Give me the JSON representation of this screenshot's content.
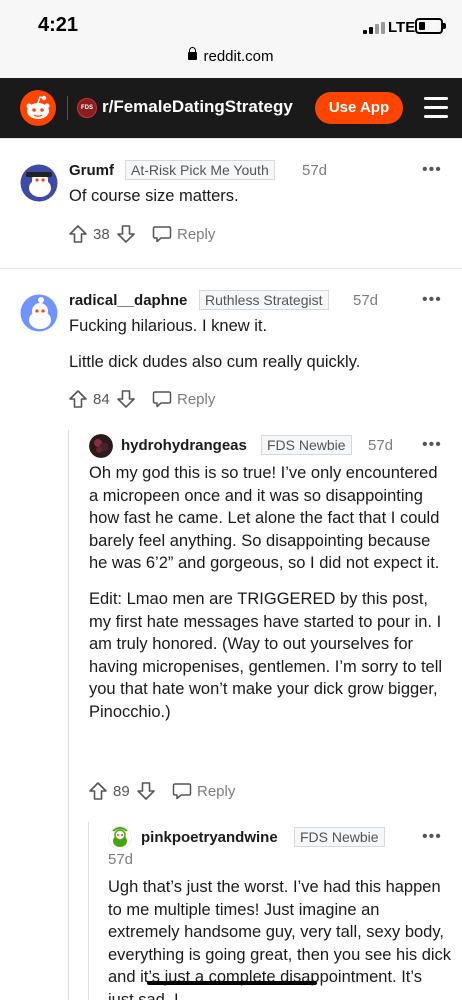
{
  "status": {
    "time": "4:21",
    "network": "LTE"
  },
  "browser": {
    "url": "reddit.com"
  },
  "header": {
    "subreddit_icon_text": "FDS",
    "subreddit": "r/FemaleDatingStrategy",
    "use_app_label": "Use App"
  },
  "comments": [
    {
      "username": "Grumf",
      "flair": "At-Risk Pick Me Youth",
      "age": "57d",
      "paragraphs": [
        "Of course size matters."
      ],
      "score": "38",
      "reply_label": "Reply"
    },
    {
      "username": "radical__daphne",
      "flair": "Ruthless Strategist",
      "age": "57d",
      "paragraphs": [
        "Fucking hilarious. I knew it.",
        "Little dick dudes also cum really quickly."
      ],
      "score": "84",
      "reply_label": "Reply"
    },
    {
      "username": "hydrohydrangeas",
      "flair": "FDS Newbie",
      "age": "57d",
      "paragraphs": [
        "Oh my god this is so true! I’ve only encountered a micropeen once and it was so disappointing how fast he came. Let alone the fact that I could barely feel anything. So disappointing because he was 6’2” and gorgeous, so I did not expect it.",
        "Edit: Lmao men are TRIGGERED by this post, my first hate messages have started to pour in. I am truly honored. (Way to out yourselves for having micropenises, gentlemen. I’m sorry to tell you that hate won’t make your dick grow bigger, Pinocchio.)"
      ],
      "score": "89",
      "reply_label": "Reply"
    },
    {
      "username": "pinkpoetryandwine",
      "flair": "FDS Newbie",
      "age": "57d",
      "paragraphs": [
        "Ugh that’s just the worst. I’ve had this happen to me multiple times! Just imagine an extremely handsome guy, very tall, sexy body, everything is going great, then you see his dick and it’s just a complete disappointment. It’s just sad. I"
      ]
    }
  ],
  "icons": {
    "snoo": "reddit-logo-icon",
    "upvote": "upvote-arrow-icon",
    "downvote": "downvote-arrow-icon",
    "reply": "comment-bubble-icon",
    "more": "more-options-icon",
    "menu": "hamburger-menu-icon"
  },
  "colors": {
    "accent": "#ff4500",
    "header_bg": "#1a1a1b"
  }
}
